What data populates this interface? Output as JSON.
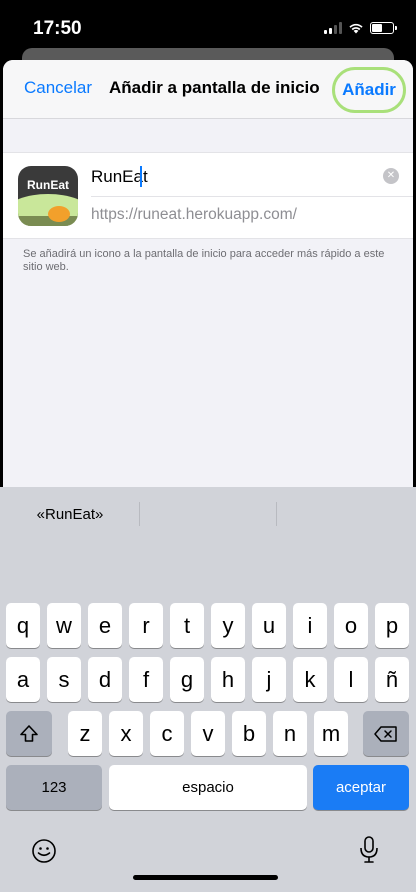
{
  "status": {
    "time": "17:50"
  },
  "nav": {
    "cancel_label": "Cancelar",
    "title": "Añadir a pantalla de inicio",
    "add_label": "Añadir"
  },
  "app": {
    "icon_brand": "RunEat",
    "name_value": "RunEat",
    "url": "https://runeat.herokuapp.com/"
  },
  "footnote": "Se añadirá un icono a la pantalla de inicio para acceder más rápido a este sitio web.",
  "keyboard": {
    "suggestion": "«RunEat»",
    "row1": [
      "q",
      "w",
      "e",
      "r",
      "t",
      "y",
      "u",
      "i",
      "o",
      "p"
    ],
    "row2": [
      "a",
      "s",
      "d",
      "f",
      "g",
      "h",
      "j",
      "k",
      "l",
      "ñ"
    ],
    "row3": [
      "z",
      "x",
      "c",
      "v",
      "b",
      "n",
      "m"
    ],
    "numbers_label": "123",
    "space_label": "espacio",
    "return_label": "aceptar"
  },
  "colors": {
    "accent": "#0a7aff",
    "highlight_ring": "#a9e07a",
    "return_key": "#1a7cf5"
  }
}
